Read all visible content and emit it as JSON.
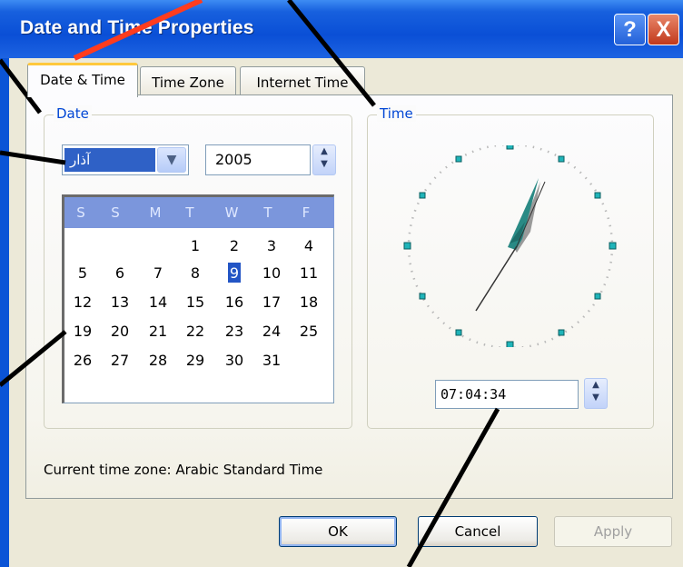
{
  "window": {
    "title": "Date and Time Properties",
    "help_button": "?",
    "close_button": "X"
  },
  "tabs": [
    {
      "label": "Date & Time",
      "active": true
    },
    {
      "label": "Time Zone",
      "active": false
    },
    {
      "label": "Internet Time",
      "active": false
    }
  ],
  "date_group": {
    "label": "Date",
    "month_value": "آذار",
    "year_value": "2005",
    "days_of_week": [
      "S",
      "S",
      "M",
      "T",
      "W",
      "T",
      "F"
    ],
    "weeks": [
      [
        "",
        "",
        "",
        "1",
        "2",
        "3",
        "4"
      ],
      [
        "5",
        "6",
        "7",
        "8",
        "9",
        "10",
        "11"
      ],
      [
        "12",
        "13",
        "14",
        "15",
        "16",
        "17",
        "18"
      ],
      [
        "19",
        "20",
        "21",
        "22",
        "23",
        "24",
        "25"
      ],
      [
        "26",
        "27",
        "28",
        "29",
        "30",
        "31",
        ""
      ]
    ],
    "selected_day": "9"
  },
  "time_group": {
    "label": "Time",
    "time_value": "07:04:34"
  },
  "current_time_zone": "Current time zone:  Arabic Standard Time",
  "buttons": {
    "ok": "OK",
    "cancel": "Cancel",
    "apply": "Apply"
  },
  "colors": {
    "titlebar": "#0a4fd6",
    "selection": "#2355c5",
    "calendar_header": "#7b96dc",
    "group_label": "#0046d5",
    "clock_hands": "#2a8a85",
    "annotation_red": "#ff3c1e",
    "annotation_black": "#000000"
  }
}
